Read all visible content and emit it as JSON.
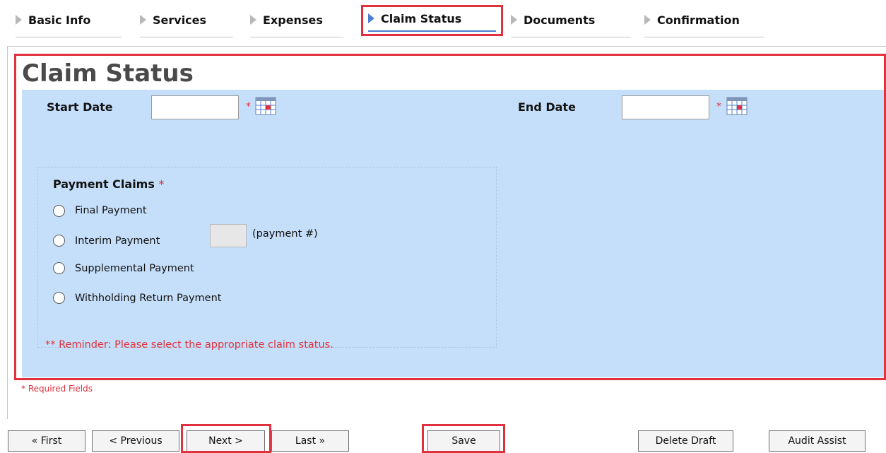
{
  "tabs": [
    {
      "label": "Basic Info"
    },
    {
      "label": "Services"
    },
    {
      "label": "Expenses"
    },
    {
      "label": "Claim Status"
    },
    {
      "label": "Documents"
    },
    {
      "label": "Confirmation"
    }
  ],
  "active_tab": "Claim Status",
  "page": {
    "title": "Claim Status",
    "start_date_label": "Start Date",
    "start_date_value": "",
    "end_date_label": "End Date",
    "end_date_value": "",
    "required_star": "*"
  },
  "payment_claims": {
    "title": "Payment Claims",
    "required_star": "*",
    "options": [
      {
        "label": "Final Payment"
      },
      {
        "label": "Interim Payment"
      },
      {
        "label": "Supplemental Payment"
      },
      {
        "label": "Withholding Return Payment"
      }
    ],
    "payment_number_value": "",
    "payment_number_label": "(payment #)",
    "reminder": "** Reminder: Please select the appropriate claim status."
  },
  "required_fields_note": "* Required Fields",
  "buttons": {
    "first": "« First",
    "previous": "< Previous",
    "next": "Next >",
    "last": "Last »",
    "save": "Save",
    "delete_draft": "Delete Draft",
    "audit_assist": "Audit Assist"
  },
  "colors": {
    "highlight": "#e0313c",
    "panel_bg": "#c5dffa",
    "active_tab": "#4a7fd4"
  },
  "icons": {
    "tab_marker": "triangle-right-icon",
    "calendar": "calendar-icon"
  }
}
